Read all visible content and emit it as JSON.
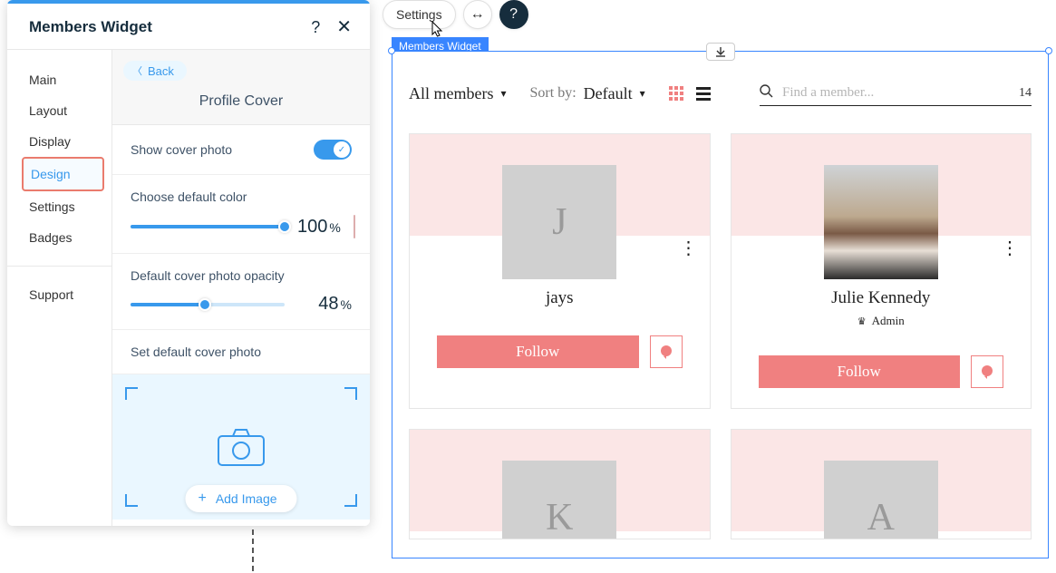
{
  "panel": {
    "title": "Members Widget",
    "help": "?",
    "close": "✕",
    "nav": {
      "main": "Main",
      "layout": "Layout",
      "display": "Display",
      "design": "Design",
      "settings": "Settings",
      "badges": "Badges",
      "support": "Support"
    },
    "back": "Back",
    "section": "Profile Cover",
    "show_cover_label": "Show cover photo",
    "choose_color_label": "Choose default color",
    "color_value": "100",
    "color_unit": "%",
    "color_hex": "#f7c1c1",
    "opacity_label": "Default cover photo opacity",
    "opacity_value": "48",
    "opacity_unit": "%",
    "set_default_label": "Set default cover photo",
    "add_image": "Add Image"
  },
  "toolbar": {
    "settings": "Settings",
    "swap": "↔",
    "help": "?"
  },
  "widget_tag": "Members Widget",
  "widget": {
    "filter": "All members",
    "sort_label": "Sort by:",
    "sort_value": "Default",
    "search_placeholder": "Find a member...",
    "count": "14",
    "follow": "Follow",
    "admin_label": "Admin",
    "members": [
      {
        "initial": "J",
        "name": "jays",
        "role": "",
        "photo": false
      },
      {
        "initial": "",
        "name": "Julie Kennedy",
        "role": "Admin",
        "photo": true
      },
      {
        "initial": "K",
        "name": "",
        "role": "",
        "photo": false
      },
      {
        "initial": "A",
        "name": "",
        "role": "",
        "photo": false
      }
    ]
  }
}
